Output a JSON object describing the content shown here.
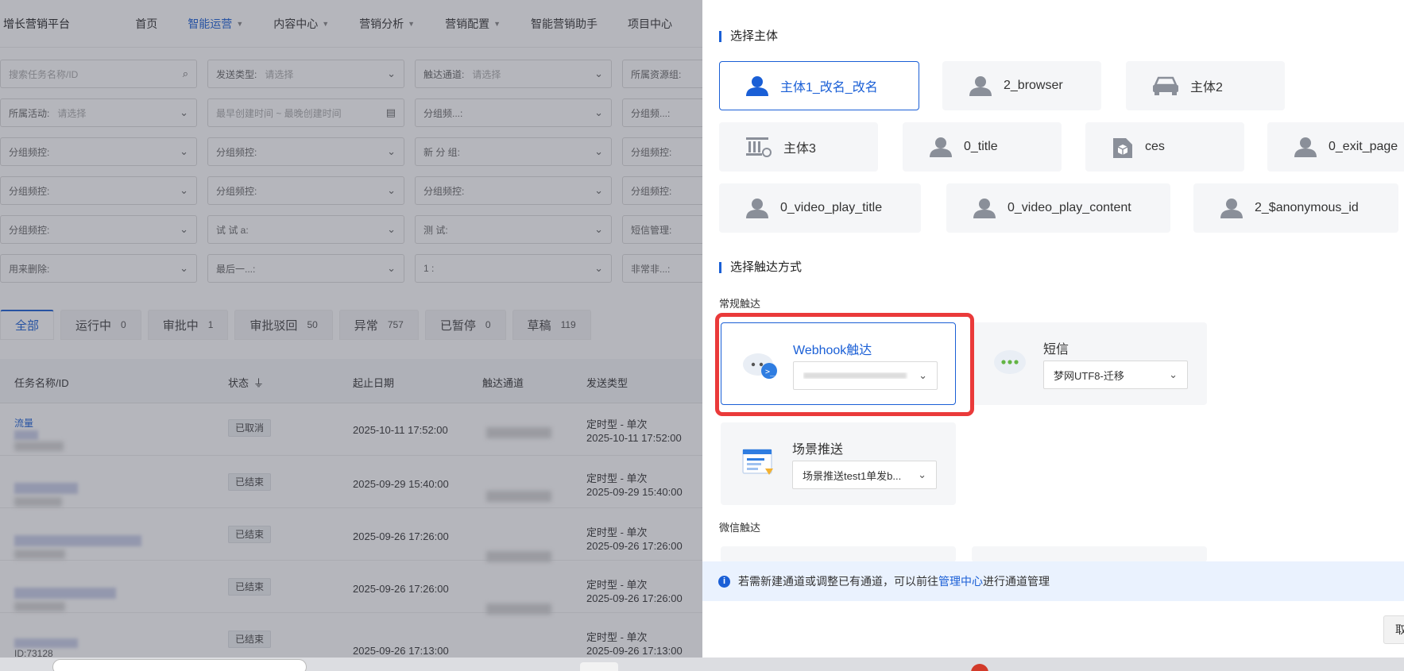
{
  "nav": {
    "brand": "增长营销平台",
    "items": [
      {
        "label": "首页",
        "caret": false,
        "active": false
      },
      {
        "label": "智能运营",
        "caret": true,
        "active": true
      },
      {
        "label": "内容中心",
        "caret": true,
        "active": false
      },
      {
        "label": "营销分析",
        "caret": true,
        "active": false
      },
      {
        "label": "营销配置",
        "caret": true,
        "active": false
      },
      {
        "label": "智能营销助手",
        "caret": false,
        "active": false
      },
      {
        "label": "项目中心",
        "caret": false,
        "active": false
      }
    ]
  },
  "filters": {
    "row1": [
      {
        "label": "",
        "placeholder": "搜索任务名称/ID",
        "icon": "search-icon"
      },
      {
        "label": "发送类型:",
        "placeholder": "请选择",
        "icon": "chevron-down-icon"
      },
      {
        "label": "触达通道:",
        "placeholder": "请选择",
        "icon": "chevron-down-icon"
      },
      {
        "label": "所属资源组:",
        "placeholder": "",
        "icon": "chevron-down-icon"
      }
    ],
    "row2": [
      {
        "label": "所属活动:",
        "placeholder": "请选择",
        "icon": "chevron-down-icon"
      },
      {
        "label": "",
        "placeholder": "最早创建时间  ~  最晚创建时间",
        "icon": "calendar-icon"
      },
      {
        "label": "分组频...:",
        "placeholder": "",
        "icon": "chevron-down-icon"
      },
      {
        "label": "分组频...:",
        "placeholder": "",
        "icon": "chevron-down-icon"
      }
    ],
    "row3": [
      {
        "label": "分组频控:",
        "placeholder": "",
        "icon": "chevron-down-icon"
      },
      {
        "label": "分组频控:",
        "placeholder": "",
        "icon": "chevron-down-icon"
      },
      {
        "label": "新 分 组:",
        "placeholder": "",
        "icon": "chevron-down-icon"
      },
      {
        "label": "分组频控:",
        "placeholder": "",
        "icon": "chevron-down-icon"
      }
    ],
    "row4": [
      {
        "label": "分组频控:",
        "placeholder": "",
        "icon": "chevron-down-icon"
      },
      {
        "label": "分组频控:",
        "placeholder": "",
        "icon": "chevron-down-icon"
      },
      {
        "label": "分组频控:",
        "placeholder": "",
        "icon": "chevron-down-icon"
      },
      {
        "label": "分组频控:",
        "placeholder": "",
        "icon": "chevron-down-icon"
      }
    ],
    "row5": [
      {
        "label": "分组频控:",
        "placeholder": "",
        "icon": "chevron-down-icon"
      },
      {
        "label": "试  试  a:",
        "placeholder": "",
        "icon": "chevron-down-icon"
      },
      {
        "label": "测      试:",
        "placeholder": "",
        "icon": "chevron-down-icon"
      },
      {
        "label": "短信管理:",
        "placeholder": "",
        "icon": "chevron-down-icon"
      }
    ],
    "row6": [
      {
        "label": "用来删除:",
        "placeholder": "",
        "icon": "chevron-down-icon"
      },
      {
        "label": "最后一...:",
        "placeholder": "",
        "icon": "chevron-down-icon"
      },
      {
        "label": "1          :",
        "placeholder": "",
        "icon": "chevron-down-icon"
      },
      {
        "label": "非常非...:",
        "placeholder": "",
        "icon": "chevron-down-icon"
      }
    ]
  },
  "status_tabs": [
    {
      "label": "全部",
      "count": "",
      "active": true
    },
    {
      "label": "运行中",
      "count": "0",
      "active": false
    },
    {
      "label": "审批中",
      "count": "1",
      "active": false
    },
    {
      "label": "审批驳回",
      "count": "50",
      "active": false
    },
    {
      "label": "异常",
      "count": "757",
      "active": false
    },
    {
      "label": "已暂停",
      "count": "0",
      "active": false
    },
    {
      "label": "草稿",
      "count": "119",
      "active": false
    }
  ],
  "table": {
    "headers": {
      "name": "任务名称/ID",
      "status": "状态",
      "date": "起止日期",
      "channel": "触达通道",
      "type": "发送类型"
    },
    "rows": [
      {
        "name": "",
        "status": "已取消",
        "date": "2025-10-11 17:52:00",
        "type": "定时型 - 单次",
        "type_date": "2025-10-11 17:52:00"
      },
      {
        "name": "",
        "status": "已结束",
        "date": "2025-09-29 15:40:00",
        "type": "定时型 - 单次",
        "type_date": "2025-09-29 15:40:00"
      },
      {
        "name": "",
        "status": "已结束",
        "date": "2025-09-26 17:26:00",
        "type": "定时型 - 单次",
        "type_date": "2025-09-26 17:26:00"
      },
      {
        "name": "",
        "status": "已结束",
        "date": "2025-09-26 17:26:00",
        "type": "定时型 - 单次",
        "type_date": "2025-09-26 17:26:00"
      },
      {
        "name": "ID:73128",
        "status": "已结束",
        "date": "2025-09-26 17:13:00",
        "type": "定时型 - 单次",
        "type_date": "2025-09-26 17:13:00"
      }
    ],
    "first_row_name_fragment": "流量"
  },
  "drawer": {
    "section_subject": "选择主体",
    "subjects": [
      {
        "label": "主体1_改名_改名",
        "icon": "person-icon",
        "selected": true
      },
      {
        "label": "2_browser",
        "icon": "person-icon",
        "selected": false
      },
      {
        "label": "主体2",
        "icon": "car-icon",
        "selected": false
      },
      {
        "label": "主体3",
        "icon": "bank-icon",
        "selected": false
      },
      {
        "label": "0_title",
        "icon": "person-icon",
        "selected": false
      },
      {
        "label": "ces",
        "icon": "cube-icon",
        "selected": false
      },
      {
        "label": "0_exit_page",
        "icon": "person-icon",
        "selected": false
      },
      {
        "label": "0_video_play_title",
        "icon": "person-icon",
        "selected": false
      },
      {
        "label": "0_video_play_content",
        "icon": "person-icon",
        "selected": false
      },
      {
        "label": "2_$anonymous_id",
        "icon": "person-icon",
        "selected": false
      }
    ],
    "section_channel": "选择触达方式",
    "group_normal": "常规触达",
    "channels": [
      {
        "name": "Webhook触达",
        "value": "",
        "icon": "webhook-cloud-icon",
        "selected": true
      },
      {
        "name": "短信",
        "value": "梦网UTF8-迁移",
        "icon": "sms-bubble-icon",
        "selected": false
      },
      {
        "name": "场景推送",
        "value": "场景推送test1单发b...",
        "icon": "scene-push-icon",
        "selected": false
      }
    ],
    "group_wechat": "微信触达",
    "notice": {
      "prefix": "若需新建通道或调整已有通道，可以前往",
      "link": "管理中心",
      "suffix": "进行通道管理"
    },
    "cancel_label": "取"
  },
  "colors": {
    "accent": "#1a5fd6",
    "highlight": "#ea3a3a",
    "notice_bg": "#eaf2fe"
  }
}
